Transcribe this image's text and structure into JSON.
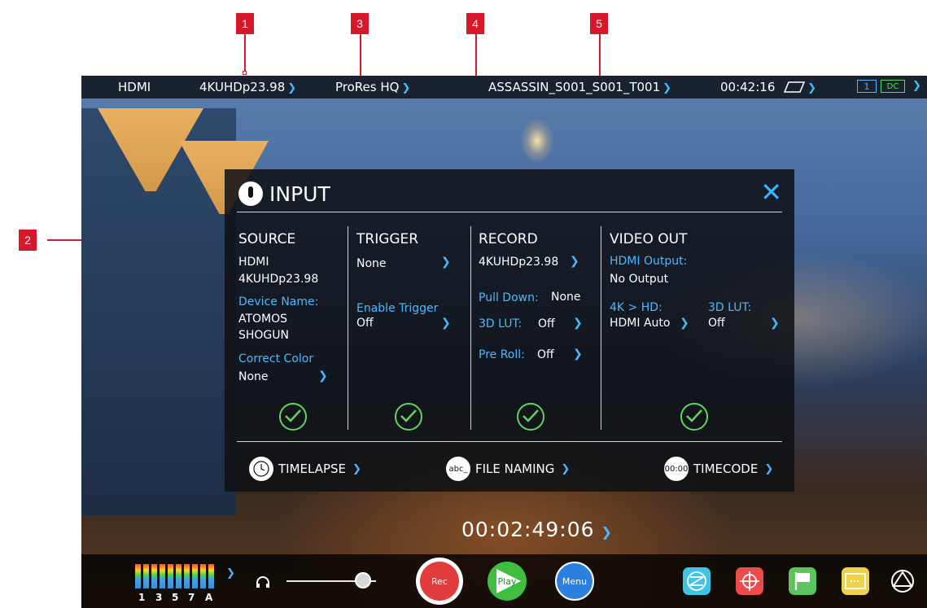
{
  "callouts": [
    "1",
    "2",
    "3",
    "4",
    "5"
  ],
  "status_bar": {
    "source": "HDMI",
    "format": "4KUHDp23.98",
    "codec": "ProRes HQ",
    "clip_name": "ASSASSIN_S001_S001_T001",
    "remaining_time": "00:42:16",
    "battery_label": "1",
    "power_label": "DC"
  },
  "panel": {
    "title": "INPUT",
    "source": {
      "heading": "SOURCE",
      "input": "HDMI",
      "format": "4KUHDp23.98",
      "device_name_label": "Device Name:",
      "device_name_line1": "ATOMOS",
      "device_name_line2": "SHOGUN",
      "correct_color_label": "Correct Color",
      "correct_color_value": "None"
    },
    "trigger": {
      "heading": "TRIGGER",
      "value": "None",
      "enable_label": "Enable Trigger",
      "enable_value": "Off"
    },
    "record": {
      "heading": "RECORD",
      "format": "4KUHDp23.98",
      "pull_down_label": "Pull Down:",
      "pull_down_value": "None",
      "lut_label": "3D LUT:",
      "lut_value": "Off",
      "pre_roll_label": "Pre Roll:",
      "pre_roll_value": "Off"
    },
    "video_out": {
      "heading": "VIDEO OUT",
      "hdmi_output_label": "HDMI Output:",
      "hdmi_output_value": "No Output",
      "downconvert_label": "4K > HD:",
      "downconvert_value": "HDMI Auto",
      "lut_label": "3D LUT:",
      "lut_value": "Off"
    },
    "bottom": {
      "timelapse": "TIMELAPSE",
      "file_naming": "FILE NAMING",
      "file_naming_icon_text": "abc_",
      "timecode": "TIMECODE",
      "timecode_icon_text": "00:00"
    }
  },
  "timecode": "00:02:49:06",
  "bottom_bar": {
    "meter_labels": [
      "1",
      "3",
      "5",
      "7",
      "A"
    ],
    "rec_label": "Rec",
    "play_label": "Play",
    "menu_label": "Menu",
    "volume_level": 0.85
  },
  "colors": {
    "accent": "#4db8ff",
    "ok_green": "#5fd65f",
    "callout_red": "#d7182a",
    "rec_red": "#e23b3b",
    "play_green": "#3fbf3f",
    "menu_blue": "#2d7fe0"
  }
}
